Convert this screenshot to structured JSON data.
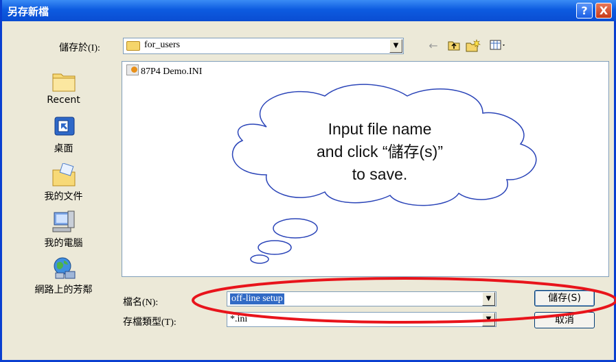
{
  "window": {
    "title": "另存新檔",
    "help_glyph": "?",
    "close_glyph": "X"
  },
  "save_in": {
    "label": "儲存於(I):",
    "value": "for_users",
    "dropdown_glyph": "▼"
  },
  "toolbar": {
    "back_glyph": "←",
    "up_glyph": "⊡",
    "new_folder_glyph": "✱",
    "view_glyph": "▦▾"
  },
  "places": [
    {
      "label": "Recent",
      "icon": "recent-folder-icon"
    },
    {
      "label": "桌面",
      "icon": "desktop-icon"
    },
    {
      "label": "我的文件",
      "icon": "my-documents-icon"
    },
    {
      "label": "我的電腦",
      "icon": "my-computer-icon"
    },
    {
      "label": "網路上的芳鄰",
      "icon": "network-places-icon"
    }
  ],
  "files": [
    {
      "name": "87P4 Demo.INI",
      "icon": "ini-file-icon"
    }
  ],
  "callout": {
    "line1": "Input file name",
    "line2": "and click “儲存(s)”",
    "line3": "to save."
  },
  "file_name": {
    "label": "檔名(N):",
    "value": "off-line setup"
  },
  "file_type": {
    "label": "存檔類型(T):",
    "value": "*.ini"
  },
  "buttons": {
    "save": "儲存(S)",
    "cancel": "取消"
  },
  "colors": {
    "title_bar": "#0A4DD2",
    "dialog_bg": "#ECE9D8",
    "annotation_red": "#E8141B",
    "selection": "#316AC5"
  }
}
